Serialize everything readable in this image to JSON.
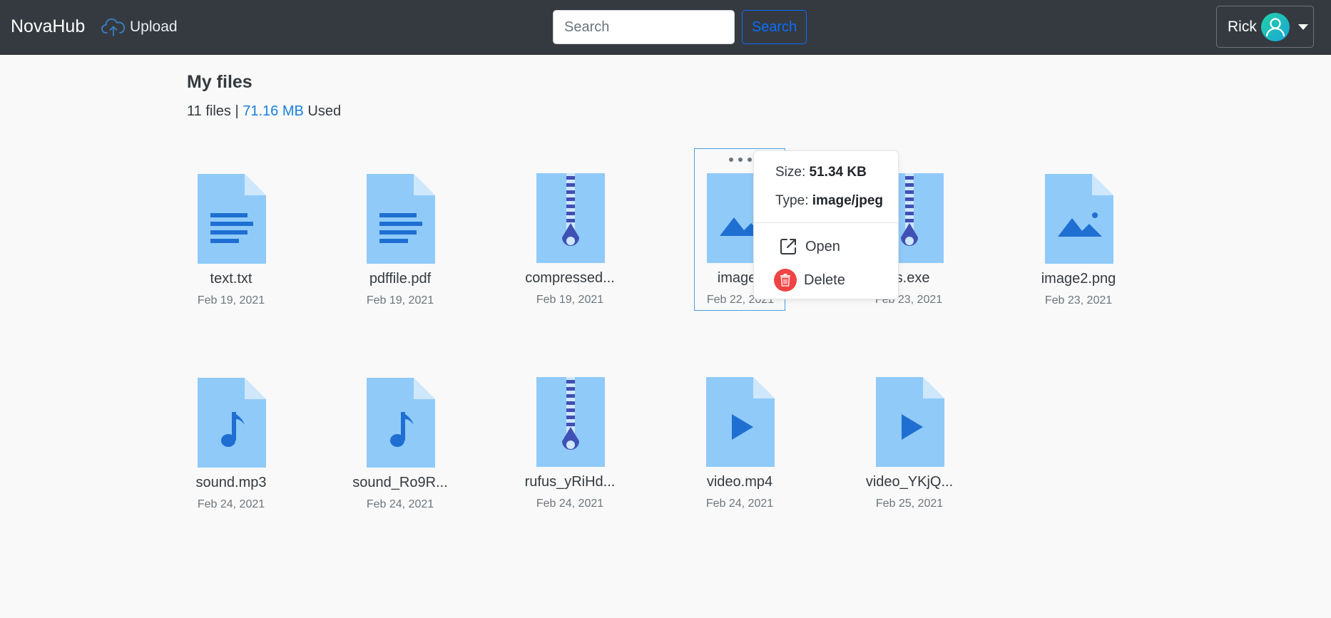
{
  "navbar": {
    "brand": "NovaHub",
    "upload_label": "Upload",
    "search_placeholder": "Search",
    "search_value": "",
    "search_button": "Search",
    "user_name": "Rick"
  },
  "page": {
    "title": "My files",
    "file_count": "11 files",
    "separator": "|",
    "used_size": "71.16 MB",
    "used_label": "Used"
  },
  "files": [
    {
      "name": "text.txt",
      "date": "Feb 19, 2021",
      "kind": "document"
    },
    {
      "name": "pdffile.pdf",
      "date": "Feb 19, 2021",
      "kind": "document"
    },
    {
      "name": "compressed...",
      "date": "Feb 19, 2021",
      "kind": "archive"
    },
    {
      "name": "image.j",
      "date": "Feb 22, 2021",
      "kind": "image"
    },
    {
      "name": "us.exe",
      "date": "Feb 23, 2021",
      "kind": "archive"
    },
    {
      "name": "image2.png",
      "date": "Feb 23, 2021",
      "kind": "image"
    },
    {
      "name": "sound.mp3",
      "date": "Feb 24, 2021",
      "kind": "audio"
    },
    {
      "name": "sound_Ro9R...",
      "date": "Feb 24, 2021",
      "kind": "audio"
    },
    {
      "name": "rufus_yRiHd...",
      "date": "Feb 24, 2021",
      "kind": "archive"
    },
    {
      "name": "video.mp4",
      "date": "Feb 24, 2021",
      "kind": "video"
    },
    {
      "name": "video_YKjQ...",
      "date": "Feb 25, 2021",
      "kind": "video"
    }
  ],
  "popover": {
    "size_label": "Size:",
    "size_value": "51.34 KB",
    "type_label": "Type:",
    "type_value": "image/jpeg",
    "open_label": "Open",
    "delete_label": "Delete"
  },
  "colors": {
    "navbar_bg": "#343a40",
    "file_icon_light": "#90caf9",
    "file_icon_dark": "#1e6fd1",
    "archive_zipper": "#3f51b5",
    "delete_red": "#ef4444",
    "accent_blue": "#0d6efd"
  }
}
